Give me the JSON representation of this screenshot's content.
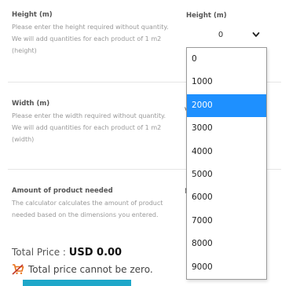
{
  "height_row": {
    "title": "Height (m)",
    "description": "Please enter the height required without quantity. We will add quantities for each product of 1 m2 (height)",
    "column_label": "Height (m)"
  },
  "width_row": {
    "title": "Width (m)",
    "description": "Please enter the width required without quantity. We will add quantities for each product of 1 m2 (width)",
    "partial_label": "V"
  },
  "amount_row": {
    "title": "Amount of product needed",
    "description": "The calculator calculates the amount of product needed based on the dimensions you entered.",
    "partial_label": "N"
  },
  "height_select": {
    "value": "0",
    "options": [
      "0",
      "1000",
      "2000",
      "3000",
      "4000",
      "5000",
      "6000",
      "7000",
      "8000",
      "9000"
    ],
    "highlighted": "2000"
  },
  "total": {
    "label": "Total Price : ",
    "amount": "USD 0.00"
  },
  "warning": {
    "text": "Total price cannot be zero.",
    "icon": "cart-cross-icon"
  },
  "colors": {
    "highlight": "#1e90ff",
    "warning_icon": "#e8711a",
    "button": "#1ea7c9"
  }
}
